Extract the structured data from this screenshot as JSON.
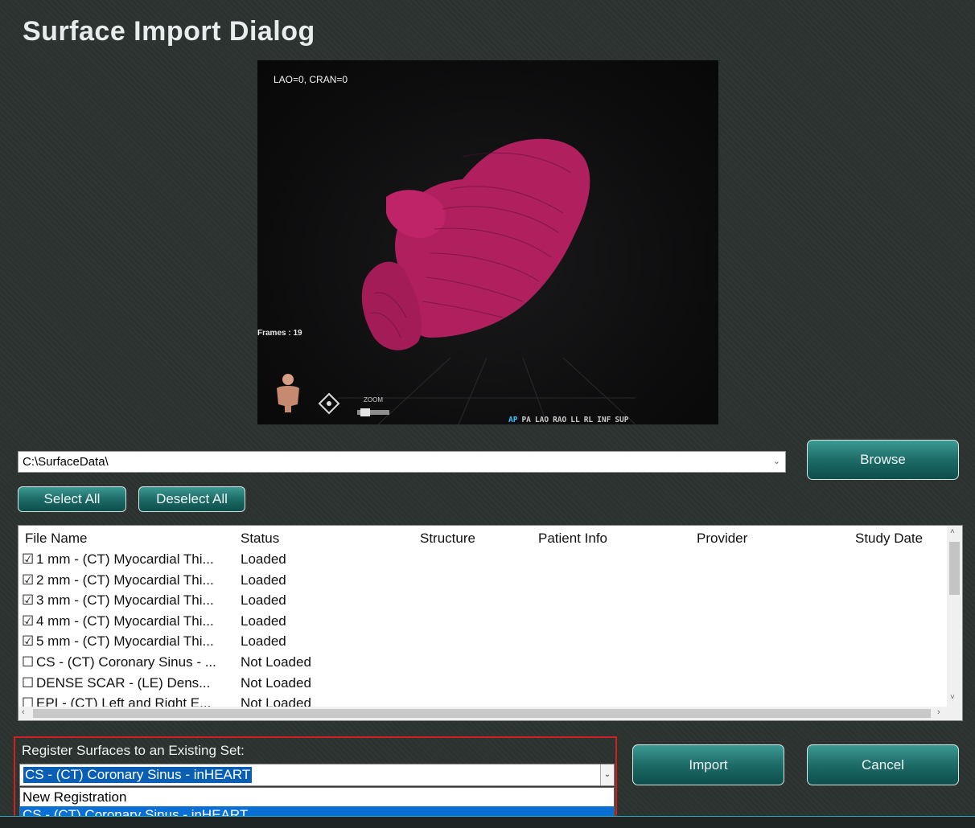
{
  "dialog": {
    "title": "Surface Import Dialog"
  },
  "viewer": {
    "view_angle": "LAO=0, CRAN=0",
    "frames": "Frames : 19",
    "zoom_label": "ZOOM",
    "orientations": [
      "AP",
      "PA",
      "LAO",
      "RAO",
      "LL",
      "RL",
      "INF",
      "SUP"
    ],
    "active_orientation": "AP",
    "model_color": "#b0205f"
  },
  "path": {
    "value": "C:\\SurfaceData\\",
    "browse_label": "Browse"
  },
  "selection": {
    "select_all_label": "Select All",
    "deselect_all_label": "Deselect All"
  },
  "table": {
    "columns": [
      "File Name",
      "Status",
      "Structure",
      "Patient Info",
      "Provider",
      "Study Date"
    ],
    "rows": [
      {
        "check": "☑",
        "name": "1 mm - (CT) Myocardial Thi...",
        "status": "Loaded"
      },
      {
        "check": "☑",
        "name": "2 mm - (CT) Myocardial Thi...",
        "status": "Loaded"
      },
      {
        "check": "☑",
        "name": "3 mm - (CT) Myocardial Thi...",
        "status": "Loaded"
      },
      {
        "check": "☑",
        "name": "4 mm - (CT) Myocardial Thi...",
        "status": "Loaded"
      },
      {
        "check": "☑",
        "name": "5 mm - (CT) Myocardial Thi...",
        "status": "Loaded"
      },
      {
        "check": "☐",
        "name": "CS - (CT) Coronary Sinus - ...",
        "status": "Not Loaded"
      },
      {
        "check": "☐",
        "name": "DENSE SCAR - (LE) Dens...",
        "status": "Not Loaded"
      },
      {
        "check": "☐",
        "name": "EPI - (CT) Left and Right E...",
        "status": "Not Loaded"
      }
    ]
  },
  "register": {
    "label": "Register Surfaces to an Existing Set:",
    "selected": "CS - (CT) Coronary Sinus - inHEART",
    "options": [
      "New Registration",
      "CS - (CT) Coronary Sinus - inHEART"
    ]
  },
  "actions": {
    "import_label": "Import",
    "cancel_label": "Cancel"
  },
  "colors": {
    "accent": "#1d6b67",
    "highlight": "#0a6fd4",
    "focus_border": "#d21f1f"
  }
}
